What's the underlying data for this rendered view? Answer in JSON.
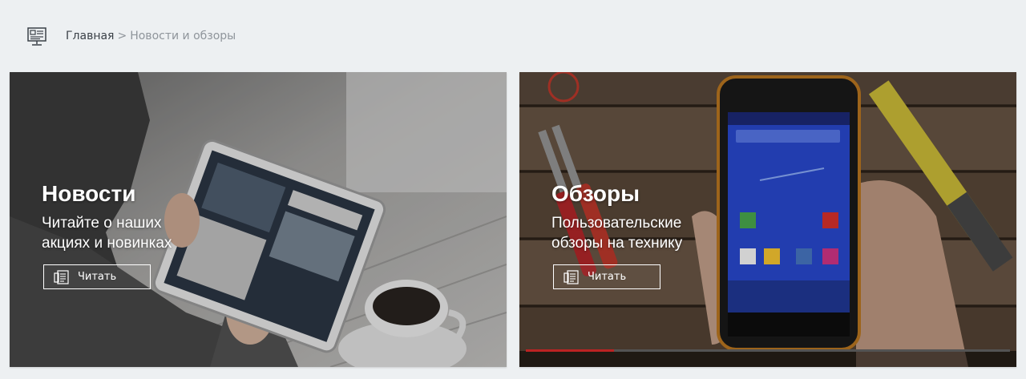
{
  "breadcrumb": {
    "icon": "news-board-icon",
    "home": "Главная",
    "separator": ">",
    "current": "Новости и обзоры"
  },
  "cards": [
    {
      "title": "Новости",
      "subtitle_line1": "Читайте о наших",
      "subtitle_line2": "акциях и новинках",
      "button_label": "Читать",
      "button_icon": "document-list-icon",
      "image": "person-with-tablet-and-coffee"
    },
    {
      "title": "Обзоры",
      "subtitle_line1": "Пользовательские",
      "subtitle_line2": "обзоры на технику",
      "button_label": "Читать",
      "button_icon": "document-list-icon",
      "image": "hand-holding-rugged-smartphone"
    }
  ]
}
